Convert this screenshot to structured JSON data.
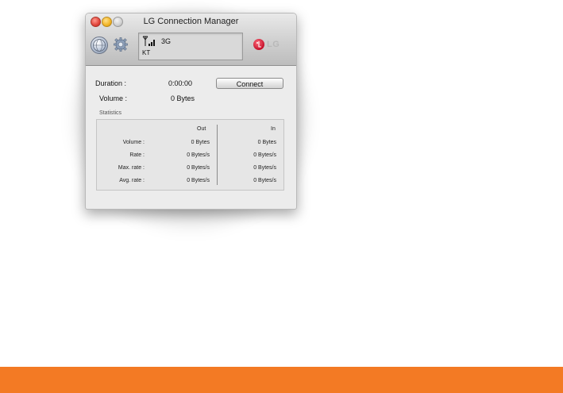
{
  "window": {
    "title": "LG Connection Manager"
  },
  "status": {
    "network_type": "3G",
    "carrier": "KT",
    "brand": "LG"
  },
  "connection": {
    "duration_label": "Duration :",
    "duration_value": "0:00:00",
    "volume_label": "Volume :",
    "volume_value": "0 Bytes",
    "connect_label": "Connect"
  },
  "statistics": {
    "title": "Statistics",
    "col_out": "Out",
    "col_in": "In",
    "rows": [
      {
        "label": "Volume :",
        "out": "0 Bytes",
        "in": "0 Bytes"
      },
      {
        "label": "Rate :",
        "out": "0 Bytes/s",
        "in": "0 Bytes/s"
      },
      {
        "label": "Max. rate :",
        "out": "0 Bytes/s",
        "in": "0 Bytes/s"
      },
      {
        "label": "Avg. rate :",
        "out": "0 Bytes/s",
        "in": "0 Bytes/s"
      }
    ]
  },
  "colors": {
    "accent_bar": "#f37a24",
    "lg_red": "#c4102a"
  },
  "icons": [
    "globe-icon",
    "gear-icon",
    "signal-icon",
    "lg-logo-icon"
  ]
}
